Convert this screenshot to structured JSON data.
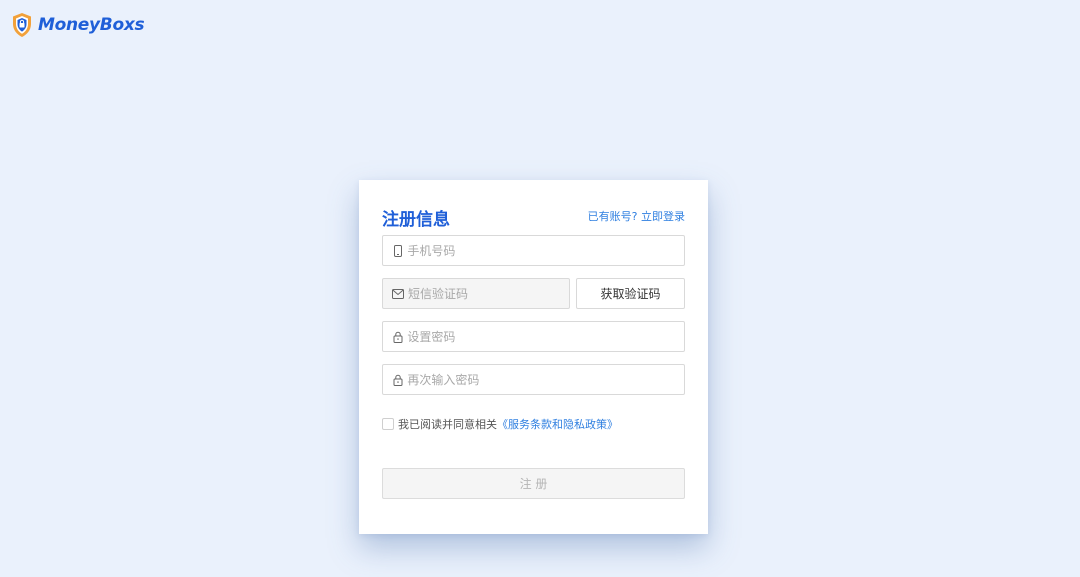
{
  "brand": {
    "name": "MoneyBoxs",
    "logo_icon": "shield-lock-icon",
    "colors": {
      "primary": "#1f5fd8",
      "accent": "#f2a13a",
      "link": "#2f7fe0",
      "background": "#eaf1fc"
    }
  },
  "form": {
    "title": "注册信息",
    "login_link": "已有账号? 立即登录",
    "phone": {
      "placeholder": "手机号码",
      "icon": "mobile-phone-icon"
    },
    "sms_code": {
      "placeholder": "短信验证码",
      "icon": "envelope-icon",
      "button_label": "获取验证码"
    },
    "password": {
      "placeholder": "设置密码",
      "icon": "lock-icon"
    },
    "confirm_password": {
      "placeholder": "再次输入密码",
      "icon": "lock-icon"
    },
    "agreement": {
      "text": "我已阅读并同意相关",
      "policy_link": "《服务条款和隐私政策》",
      "checked": false
    },
    "submit_label": "注 册"
  }
}
